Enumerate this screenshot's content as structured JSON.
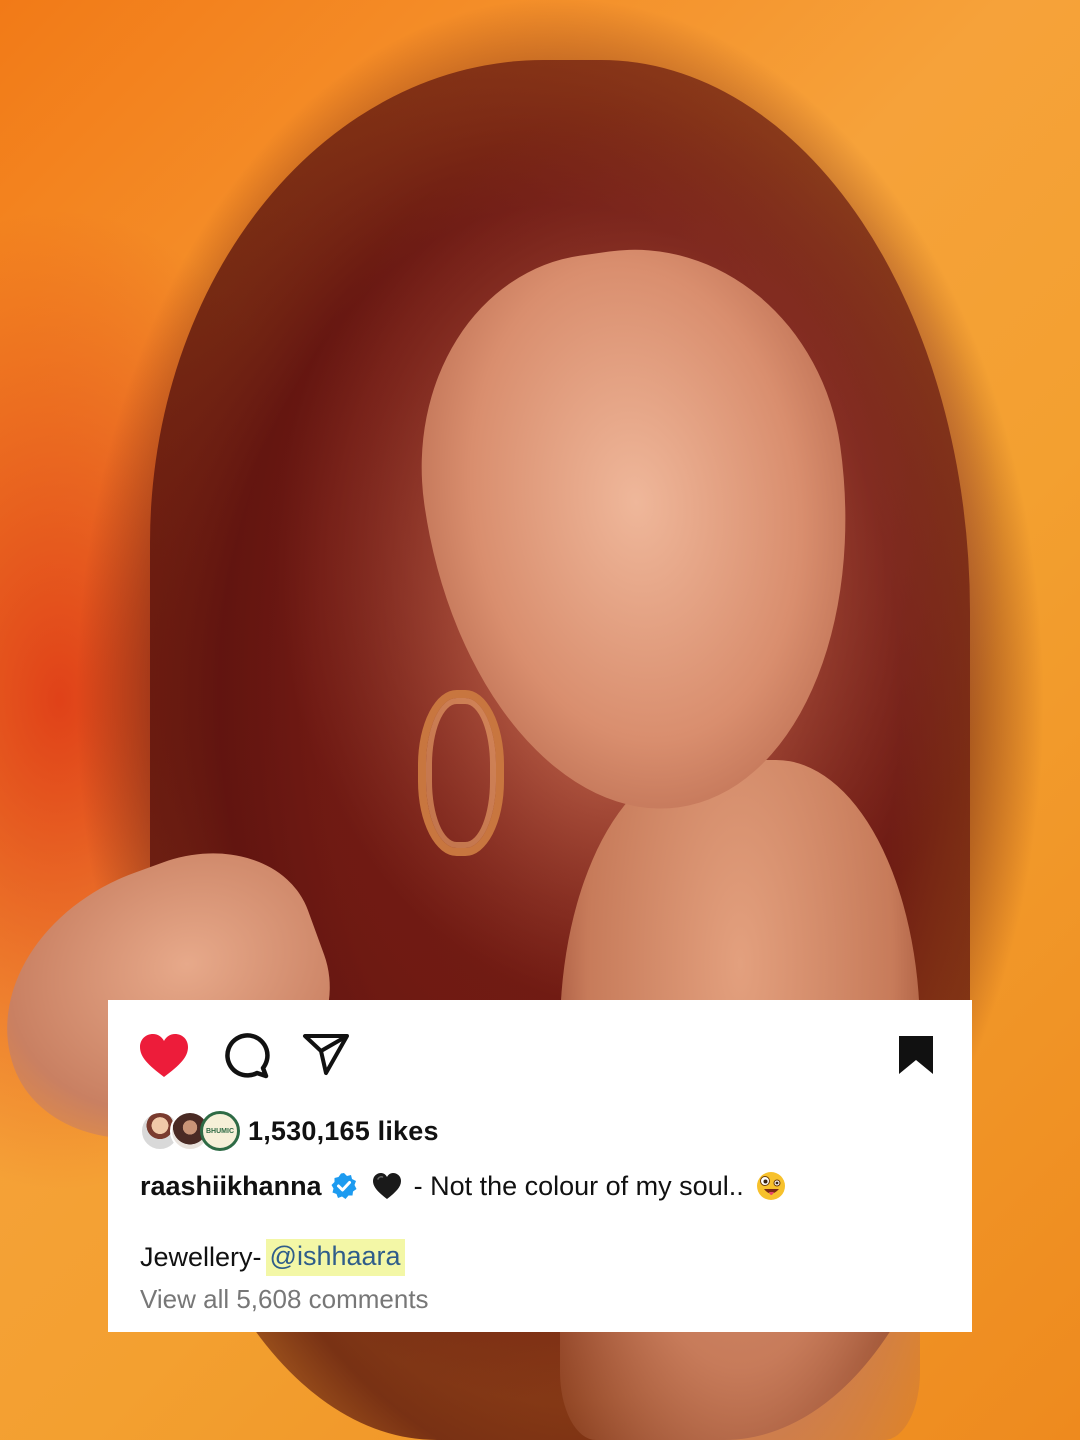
{
  "post": {
    "like_count": "1,530,165 likes",
    "username": "raashiikhanna",
    "caption": "- Not the colour of my soul..",
    "jewellery_label": "Jewellery-",
    "mention": "@ishhaara",
    "view_comments": "View all 5,608 comments",
    "liked_by_avatars": [
      {
        "name": "avatar-1"
      },
      {
        "name": "avatar-2"
      },
      {
        "name": "avatar-3",
        "text": "BHUMIC"
      }
    ]
  },
  "icons": {
    "like": "heart-filled-icon",
    "comment": "comment-bubble-icon",
    "share": "paper-plane-icon",
    "save": "bookmark-filled-icon",
    "verified": "verified-badge-icon",
    "caption_emoji_1": "black-heart-icon",
    "caption_emoji_2": "zany-face-emoji-icon"
  },
  "colors": {
    "like_red": "#ed1c3a",
    "verified_blue": "#1d9bf0",
    "mention_highlight": "#f3f7a6",
    "mention_text": "#2f5d8a",
    "background_orange": "#f08a1c"
  }
}
